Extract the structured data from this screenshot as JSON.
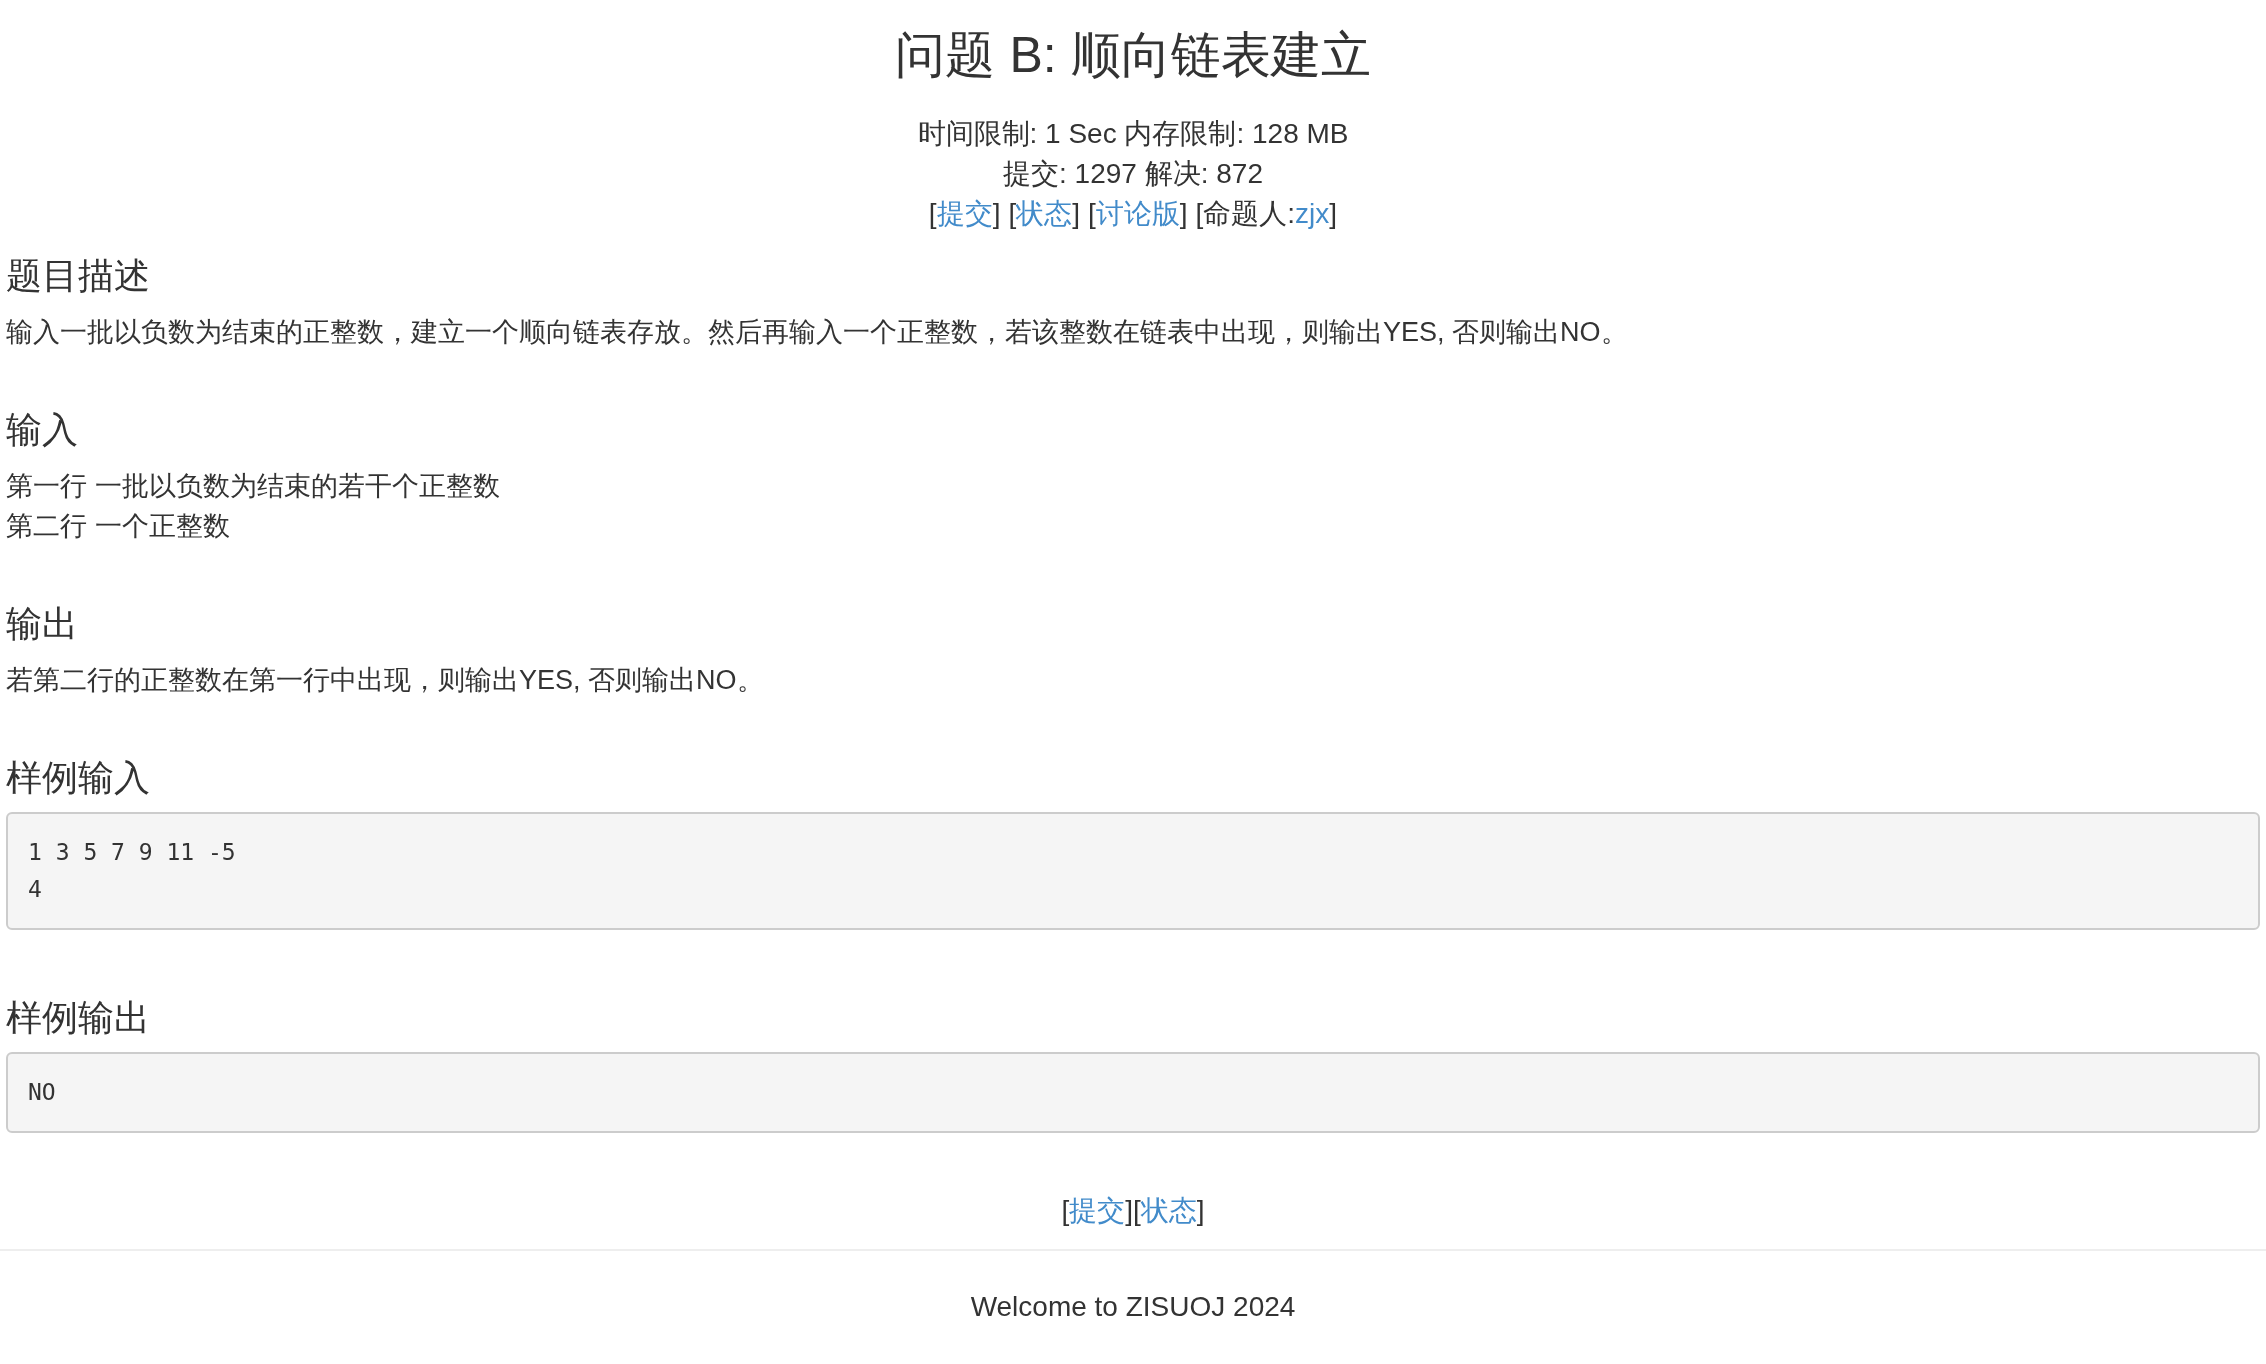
{
  "title": "问题 B: 顺向链表建立",
  "limits": [
    "时间限制: 1 Sec  内存限制: 128 MB",
    "提交: 1297  解决: 872"
  ],
  "top_links": [
    {
      "prefix": "[",
      "label": "提交",
      "suffix": "]"
    },
    {
      "prefix": "[",
      "label": "状态",
      "suffix": "]"
    },
    {
      "prefix": "[",
      "label": "讨论版",
      "suffix": "]"
    },
    {
      "prefix": "[命题人:",
      "label": "zjx",
      "suffix": "]"
    }
  ],
  "sections": [
    {
      "kind": "text",
      "heading": "题目描述",
      "lines": [
        "输入一批以负数为结束的正整数，建立一个顺向链表存放。然后再输入一个正整数，若该整数在链表中出现，则输出YES, 否则输出NO。"
      ]
    },
    {
      "kind": "text",
      "heading": "输入",
      "lines": [
        "第一行 一批以负数为结束的若干个正整数",
        "第二行 一个正整数"
      ]
    },
    {
      "kind": "text",
      "heading": "输出",
      "lines": [
        "若第二行的正整数在第一行中出现，则输出YES, 否则输出NO。"
      ]
    },
    {
      "kind": "code",
      "heading": "样例输入",
      "lines": [
        "1 3 5 7 9 11 -5",
        "4"
      ]
    },
    {
      "kind": "code",
      "heading": "样例输出",
      "lines": [
        "NO"
      ]
    }
  ],
  "bottom_links": [
    {
      "prefix": "[",
      "label": "提交",
      "suffix": "]"
    },
    {
      "prefix": "[",
      "label": "状态",
      "suffix": "]"
    }
  ],
  "footer": "Welcome to ZISUOJ 2024"
}
